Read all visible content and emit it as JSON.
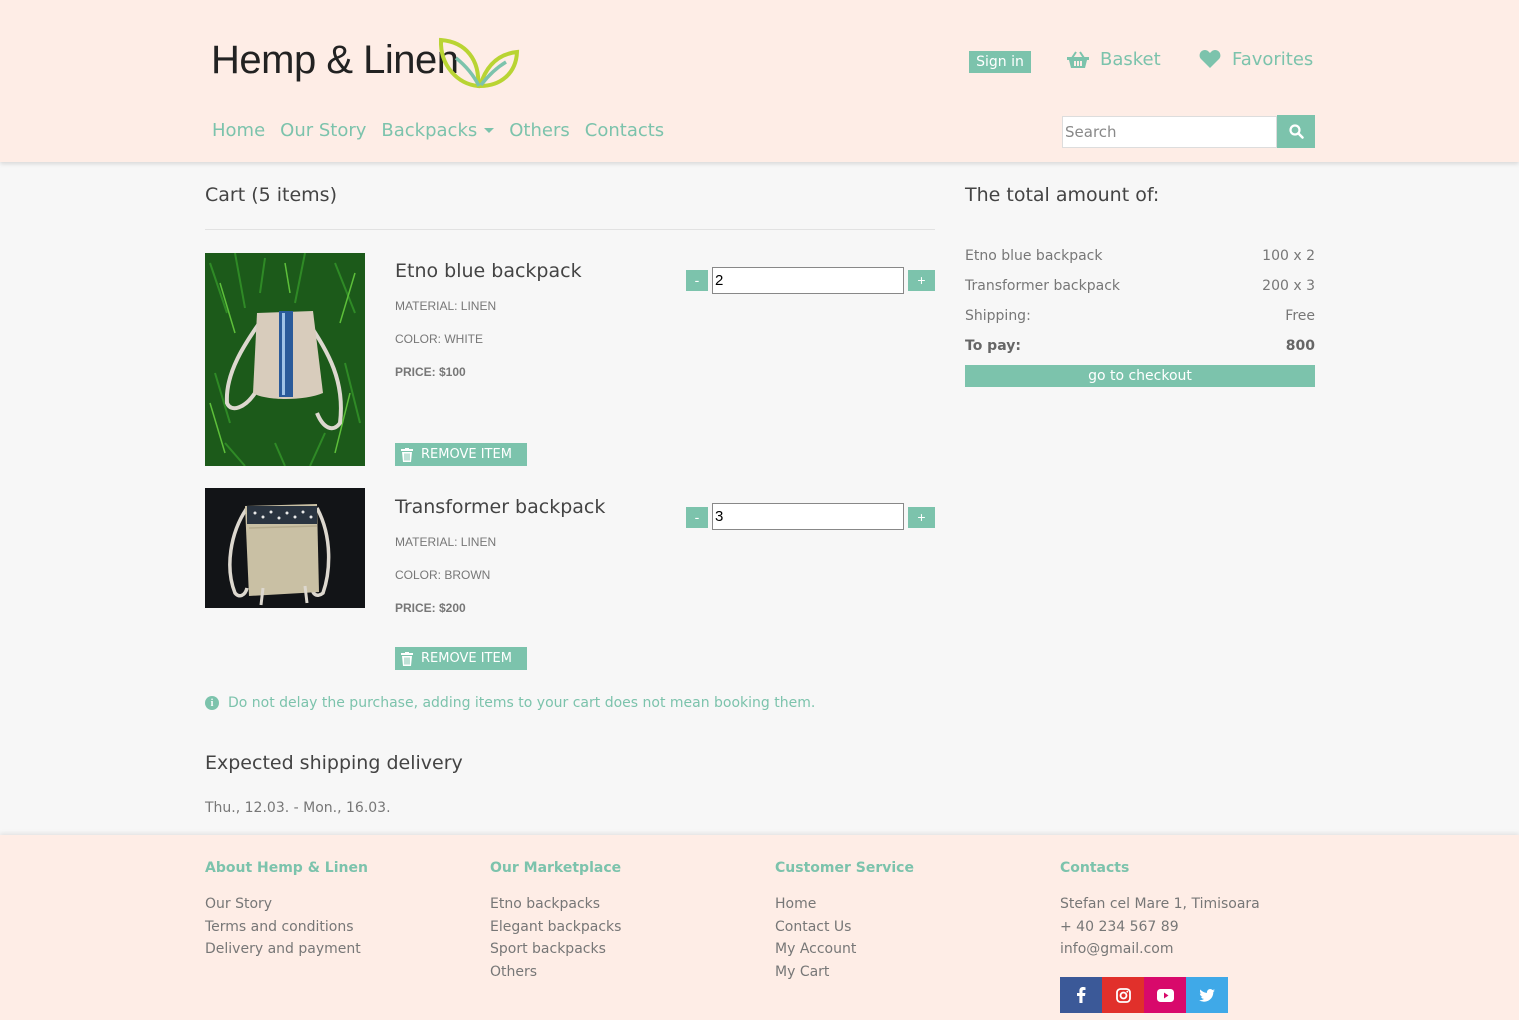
{
  "brand": {
    "name": "Hemp & Linen",
    "accent": "#7cc3ac",
    "header_bg": "#feede6"
  },
  "header": {
    "signin_label": "Sign in",
    "basket_label": "Basket",
    "favorites_label": "Favorites",
    "nav": [
      "Home",
      "Our Story",
      "Backpacks",
      "Others",
      "Contacts"
    ],
    "search_placeholder": "Search"
  },
  "cart": {
    "title": "Cart (5 items)",
    "items": [
      {
        "name": "Etno blue backpack",
        "material": "MATERIAL: LINEN",
        "color": "COLOR: WHITE",
        "price": "PRICE: $100",
        "qty": "2",
        "remove_label": "REMOVE ITEM"
      },
      {
        "name": "Transformer backpack",
        "material": "MATERIAL: LINEN",
        "color": "COLOR: BROWN",
        "price": "PRICE: $200",
        "qty": "3",
        "remove_label": "REMOVE ITEM"
      }
    ],
    "minus_label": "-",
    "plus_label": "+",
    "notice": "Do not delay the purchase, adding items to your cart does not mean booking them.",
    "shipping_title": "Expected shipping delivery",
    "shipping_dates": "Thu., 12.03. - Mon., 16.03."
  },
  "summary": {
    "title": "The total amount of:",
    "rows": [
      {
        "label": "Etno blue backpack",
        "value": "100 x 2"
      },
      {
        "label": "Transformer backpack",
        "value": "200 x 3"
      },
      {
        "label": "Shipping:",
        "value": "Free"
      },
      {
        "label": "To pay:",
        "value": "800"
      }
    ],
    "checkout_label": "go to checkout"
  },
  "footer": {
    "columns": [
      {
        "title": "About Hemp & Linen",
        "links": [
          "Our Story",
          "Terms and conditions",
          "Delivery and payment"
        ]
      },
      {
        "title": "Our Marketplace",
        "links": [
          "Etno backpacks",
          "Elegant backpacks",
          "Sport backpacks",
          "Others"
        ]
      },
      {
        "title": "Customer Service",
        "links": [
          "Home",
          "Contact Us",
          "My Account",
          "My Cart"
        ]
      },
      {
        "title": "Contacts",
        "links": [
          "Stefan cel Mare 1, Timisoara",
          "+ 40 234 567 89",
          "info@gmail.com"
        ]
      }
    ],
    "social": [
      {
        "icon": "facebook-icon",
        "color": "#3b5998"
      },
      {
        "icon": "instagram-icon",
        "color": "#e1302b"
      },
      {
        "icon": "youtube-icon",
        "color": "#d8096b"
      },
      {
        "icon": "twitter-icon",
        "color": "#3fa9e8"
      }
    ]
  }
}
